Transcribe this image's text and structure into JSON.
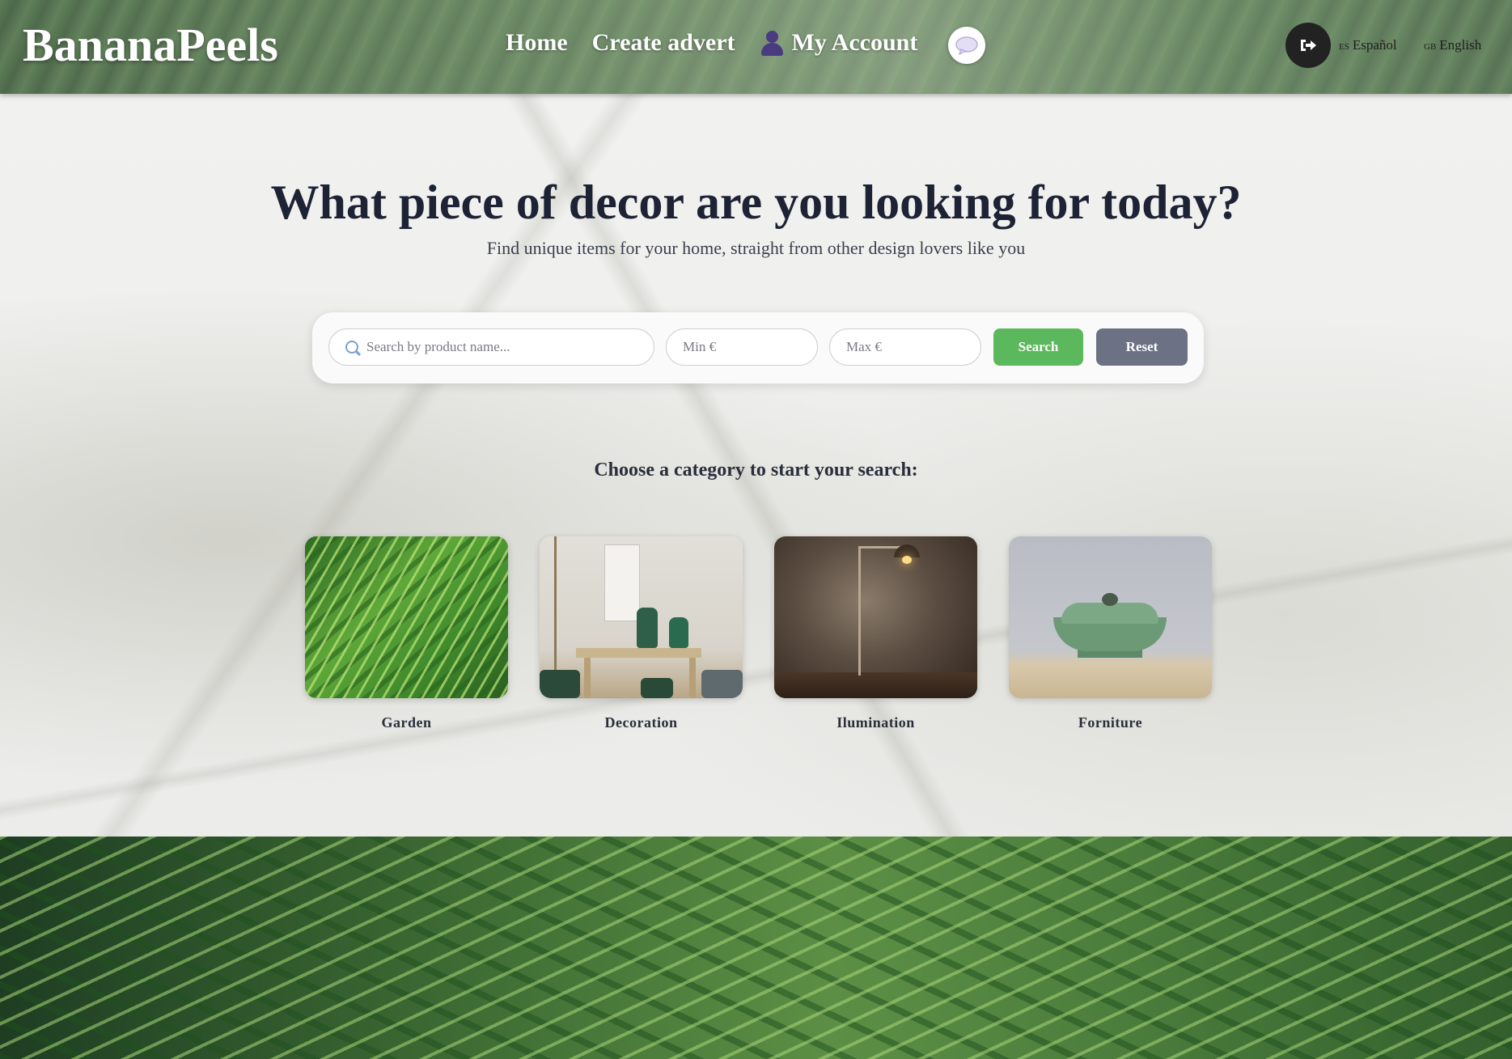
{
  "header": {
    "logo": "BananaPeels",
    "nav": {
      "home": "Home",
      "create_advert": "Create advert",
      "my_account": "My Account"
    },
    "icons": {
      "user": "user-icon",
      "chat": "chat-bubble-icon",
      "logout": "logout-icon"
    },
    "languages": [
      {
        "code": "ES",
        "label": "Español"
      },
      {
        "code": "GB",
        "label": "English"
      }
    ]
  },
  "hero": {
    "title": "What piece of decor are you looking for today?",
    "subtitle": "Find unique items for your home, straight from other design lovers like you"
  },
  "search": {
    "name_placeholder": "Search by product name...",
    "min_placeholder": "Min €",
    "max_placeholder": "Max €",
    "search_label": "Search",
    "reset_label": "Reset",
    "search_color": "#5cb85c",
    "reset_color": "#6c7283"
  },
  "categories": {
    "heading": "Choose a category to start your search:",
    "items": [
      {
        "label": "Garden"
      },
      {
        "label": "Decoration"
      },
      {
        "label": "Ilumination"
      },
      {
        "label": "Forniture"
      }
    ]
  }
}
